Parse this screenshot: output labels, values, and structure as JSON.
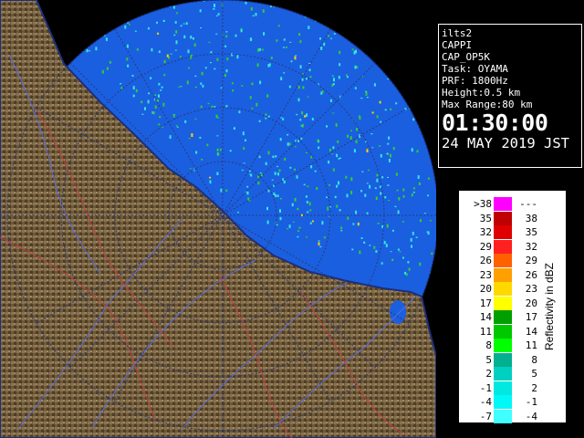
{
  "info": {
    "site": "ilts2",
    "product": "CAPPI",
    "op_mode": "CAP_OP5K",
    "task": "Task: OYAMA",
    "prf": "PRF: 1800Hz",
    "height": "Height:0.5 km",
    "max_range": "Max Range:80 km",
    "time": "01:30:00",
    "date": "24 MAY 2019 JST"
  },
  "legend": {
    "unit_label": "Reflectivity in dBZ",
    "rows": [
      {
        "lo": ">38",
        "hi": "---",
        "color": "#ff00ff"
      },
      {
        "lo": "35",
        "hi": "38",
        "color": "#c00000"
      },
      {
        "lo": "32",
        "hi": "35",
        "color": "#e00000"
      },
      {
        "lo": "29",
        "hi": "32",
        "color": "#ff2020"
      },
      {
        "lo": "26",
        "hi": "29",
        "color": "#ff6000"
      },
      {
        "lo": "23",
        "hi": "26",
        "color": "#ffa000"
      },
      {
        "lo": "20",
        "hi": "23",
        "color": "#ffd800"
      },
      {
        "lo": "17",
        "hi": "20",
        "color": "#ffff00"
      },
      {
        "lo": "14",
        "hi": "17",
        "color": "#00a000"
      },
      {
        "lo": "11",
        "hi": "14",
        "color": "#00c800"
      },
      {
        "lo": "8",
        "hi": "11",
        "color": "#00ff00"
      },
      {
        "lo": "5",
        "hi": "8",
        "color": "#00b090"
      },
      {
        "lo": "2",
        "hi": "5",
        "color": "#00d0c0"
      },
      {
        "lo": "-1",
        "hi": "2",
        "color": "#00e8e0"
      },
      {
        "lo": "-4",
        "hi": "-1",
        "color": "#00f8f8"
      },
      {
        "lo": "-7",
        "hi": "-4",
        "color": "#40ffff"
      }
    ]
  },
  "colors": {
    "sea": "#1a5fe0",
    "land": "#6b5838",
    "coast": "#1e2f7a",
    "echo_weak": "#33e6e6",
    "echo_mod": "#33cc33",
    "echo_strong": "#ffd000"
  }
}
